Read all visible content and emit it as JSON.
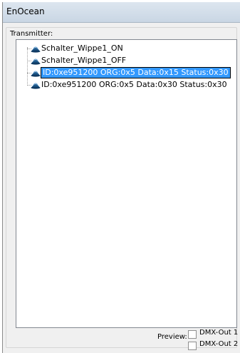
{
  "window": {
    "title": "EnOcean"
  },
  "transmitter": {
    "label": "Transmitter:",
    "items": [
      {
        "label": "Schalter_Wippe1_ON",
        "selected": false
      },
      {
        "label": "Schalter_Wippe1_OFF",
        "selected": false
      },
      {
        "label": "ID:0xe951200 ORG:0x5 Data:0x15 Status:0x30",
        "selected": true
      },
      {
        "label": "ID:0xe951200 ORG:0x5 Data:0x30 Status:0x30",
        "selected": false
      }
    ]
  },
  "preview": {
    "label": "Preview:",
    "options": [
      {
        "label": "DMX-Out 1",
        "checked": false
      },
      {
        "label": "DMX-Out 2",
        "checked": false
      }
    ]
  },
  "icons": {
    "tree_item": "transmitter-icon"
  },
  "colors": {
    "selection": "#3399ff",
    "icon": "#1f5a8c"
  }
}
